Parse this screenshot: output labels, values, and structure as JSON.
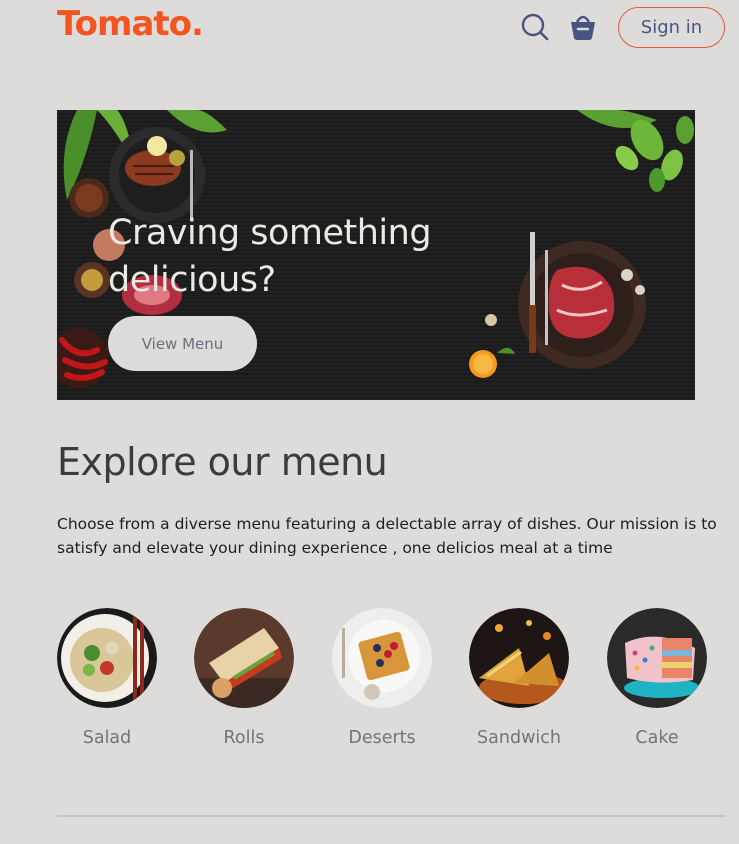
{
  "header": {
    "logo": "Tomato.",
    "signin_label": "Sign in",
    "icons": [
      "search-icon",
      "basket-icon"
    ]
  },
  "hero": {
    "title": "Craving something delicious?",
    "button_label": "View Menu"
  },
  "explore": {
    "title": "Explore our menu",
    "description": "Choose from a diverse menu featuring a delectable array of dishes. Our mission is to satisfy and elevate your dining experience , one delicios meal at a time"
  },
  "menu": {
    "items": [
      {
        "label": "Salad"
      },
      {
        "label": "Rolls"
      },
      {
        "label": "Deserts"
      },
      {
        "label": "Sandwich"
      },
      {
        "label": "Cake"
      }
    ]
  },
  "colors": {
    "brand": "#f4541f",
    "background": "#dedcda",
    "nav_text": "#49557e"
  }
}
